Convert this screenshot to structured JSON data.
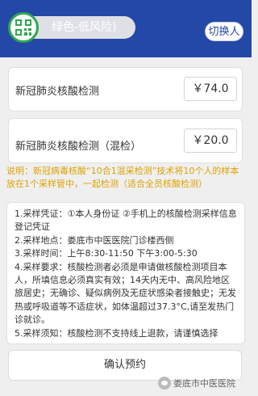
{
  "header": {
    "status_text": "绿色-低风险)",
    "switch_label": "切换人",
    "status_color": "#2ea84f",
    "header_color": "#2448a8",
    "icon": "qr-code-icon"
  },
  "items": [
    {
      "name": "新冠肺炎核酸检测",
      "price": "￥74.0"
    },
    {
      "name": "新冠肺炎核酸检测（混检）",
      "price": "￥20.0"
    }
  ],
  "note": "说明：新冠病毒核酸“10合1混采检测”技术将10个人的样本放在1个采样管中，一起检测（适合全员核酸检测）",
  "info_lines": [
    "1.采样凭证：①本人身份证 ②手机上的核酸检测采样信息登记凭证",
    "2.采样地点：娄底市中医医院门诊楼西侧",
    "3.采样时间：上午8:30-11:50 下午3:00-5:30",
    "4.采样要求：核酸检测者必须是申请做核酸检测项目本人，所填信息必须真实有效；14天内无中、高风险地区旅居史；无确诊、疑似病例及无症状感染者接触史；无发热或呼吸道等不适症状，如体温超过37.3°C,请至发热门诊就诊。",
    "5.采样须知：核酸检测不支持线上退款，请谨慎选择"
  ],
  "confirm_label": "确认预约",
  "watermark": "娄底市中医医院",
  "note_color": "#e0a100"
}
